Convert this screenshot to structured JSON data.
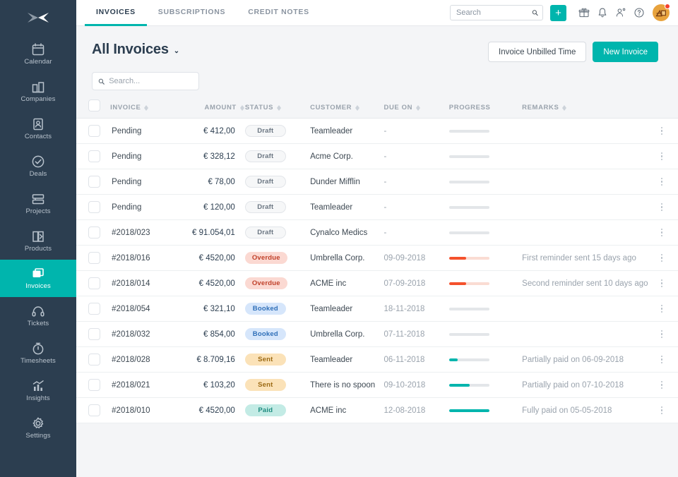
{
  "brand": {
    "accent": "#00b5ad",
    "sidebar_bg": "#2c3e50",
    "logo_name": "teamleader-logo"
  },
  "sidebar": {
    "items": [
      {
        "label": "Calendar",
        "icon": "calendar-icon",
        "active": false
      },
      {
        "label": "Companies",
        "icon": "companies-icon",
        "active": false
      },
      {
        "label": "Contacts",
        "icon": "contacts-icon",
        "active": false
      },
      {
        "label": "Deals",
        "icon": "deals-icon",
        "active": false
      },
      {
        "label": "Projects",
        "icon": "projects-icon",
        "active": false
      },
      {
        "label": "Products",
        "icon": "products-icon",
        "active": false
      },
      {
        "label": "Invoices",
        "icon": "invoices-icon",
        "active": true
      },
      {
        "label": "Tickets",
        "icon": "tickets-icon",
        "active": false
      },
      {
        "label": "Timesheets",
        "icon": "timesheets-icon",
        "active": false
      },
      {
        "label": "Insights",
        "icon": "insights-icon",
        "active": false
      },
      {
        "label": "Settings",
        "icon": "settings-icon",
        "active": false
      }
    ]
  },
  "topbar": {
    "tabs": [
      {
        "label": "INVOICES",
        "active": true
      },
      {
        "label": "SUBSCRIPTIONS",
        "active": false
      },
      {
        "label": "CREDIT NOTES",
        "active": false
      }
    ],
    "search_placeholder": "Search",
    "search_value": "",
    "add_label": "+",
    "icons": [
      "gift-icon",
      "bell-icon",
      "people-icon",
      "help-icon"
    ],
    "avatar_name": "user-avatar",
    "notification_dot_color": "#f4412e"
  },
  "page": {
    "title": "All Invoices",
    "title_caret": "⌄",
    "btn_secondary": "Invoice Unbilled Time",
    "btn_primary": "New Invoice",
    "list_search_placeholder": "Search...",
    "list_search_value": ""
  },
  "table": {
    "headers": [
      {
        "label": "INVOICE",
        "sortable": true
      },
      {
        "label": "AMOUNT",
        "sortable": true
      },
      {
        "label": "STATUS",
        "sortable": true
      },
      {
        "label": "CUSTOMER",
        "sortable": true
      },
      {
        "label": "DUE ON",
        "sortable": true
      },
      {
        "label": "PROGRESS",
        "sortable": false
      },
      {
        "label": "REMARKS",
        "sortable": true
      }
    ],
    "rows": [
      {
        "invoice": "Pending",
        "amount": "€ 412,00",
        "status": "Draft",
        "status_class": "badge-draft",
        "customer": "Teamleader",
        "due": "-",
        "progress": 0,
        "progress_color": "#e3e6e9",
        "progress_track": "#e3e6e9",
        "remarks": ""
      },
      {
        "invoice": "Pending",
        "amount": "€ 328,12",
        "status": "Draft",
        "status_class": "badge-draft",
        "customer": "Acme Corp.",
        "due": "-",
        "progress": 0,
        "progress_color": "#e3e6e9",
        "progress_track": "#e3e6e9",
        "remarks": ""
      },
      {
        "invoice": "Pending",
        "amount": "€ 78,00",
        "status": "Draft",
        "status_class": "badge-draft",
        "customer": "Dunder Mifflin",
        "due": "-",
        "progress": 0,
        "progress_color": "#e3e6e9",
        "progress_track": "#e3e6e9",
        "remarks": ""
      },
      {
        "invoice": "Pending",
        "amount": "€ 120,00",
        "status": "Draft",
        "status_class": "badge-draft",
        "customer": "Teamleader",
        "due": "-",
        "progress": 0,
        "progress_color": "#e3e6e9",
        "progress_track": "#e3e6e9",
        "remarks": ""
      },
      {
        "invoice": "#2018/023",
        "amount": "€ 91.054,01",
        "status": "Draft",
        "status_class": "badge-draft",
        "customer": "Cynalco Medics",
        "due": "-",
        "progress": 0,
        "progress_color": "#e3e6e9",
        "progress_track": "#e3e6e9",
        "remarks": ""
      },
      {
        "invoice": "#2018/016",
        "amount": "€ 4520,00",
        "status": "Overdue",
        "status_class": "badge-overdue",
        "customer": "Umbrella Corp.",
        "due": "09-09-2018",
        "progress": 42,
        "progress_color": "#f4512c",
        "progress_track": "#fadcd3",
        "remarks": "First reminder sent 15 days ago"
      },
      {
        "invoice": "#2018/014",
        "amount": "€ 4520,00",
        "status": "Overdue",
        "status_class": "badge-overdue",
        "customer": "ACME inc",
        "due": "07-09-2018",
        "progress": 42,
        "progress_color": "#f4512c",
        "progress_track": "#fadcd3",
        "remarks": "Second reminder sent 10 days ago"
      },
      {
        "invoice": "#2018/054",
        "amount": "€ 321,10",
        "status": "Booked",
        "status_class": "badge-booked",
        "customer": "Teamleader",
        "due": "18-11-2018",
        "progress": 0,
        "progress_color": "#e3e6e9",
        "progress_track": "#e3e6e9",
        "remarks": ""
      },
      {
        "invoice": "#2018/032",
        "amount": "€ 854,00",
        "status": "Booked",
        "status_class": "badge-booked",
        "customer": "Umbrella Corp.",
        "due": "07-11-2018",
        "progress": 0,
        "progress_color": "#e3e6e9",
        "progress_track": "#e3e6e9",
        "remarks": ""
      },
      {
        "invoice": "#2018/028",
        "amount": "€ 8.709,16",
        "status": "Sent",
        "status_class": "badge-sent",
        "customer": "Teamleader",
        "due": "06-11-2018",
        "progress": 22,
        "progress_color": "#00b5ad",
        "progress_track": "#e3e6e9",
        "remarks": "Partially paid on 06-09-2018"
      },
      {
        "invoice": "#2018/021",
        "amount": "€ 103,20",
        "status": "Sent",
        "status_class": "badge-sent",
        "customer": "There is no spoon",
        "due": "09-10-2018",
        "progress": 52,
        "progress_color": "#00b5ad",
        "progress_track": "#e3e6e9",
        "remarks": "Partially paid on 07-10-2018"
      },
      {
        "invoice": "#2018/010",
        "amount": "€ 4520,00",
        "status": "Paid",
        "status_class": "badge-paid",
        "customer": "ACME inc",
        "due": "12-08-2018",
        "progress": 100,
        "progress_color": "#00b5ad",
        "progress_track": "#e3e6e9",
        "remarks": "Fully paid on 05-05-2018"
      }
    ]
  }
}
